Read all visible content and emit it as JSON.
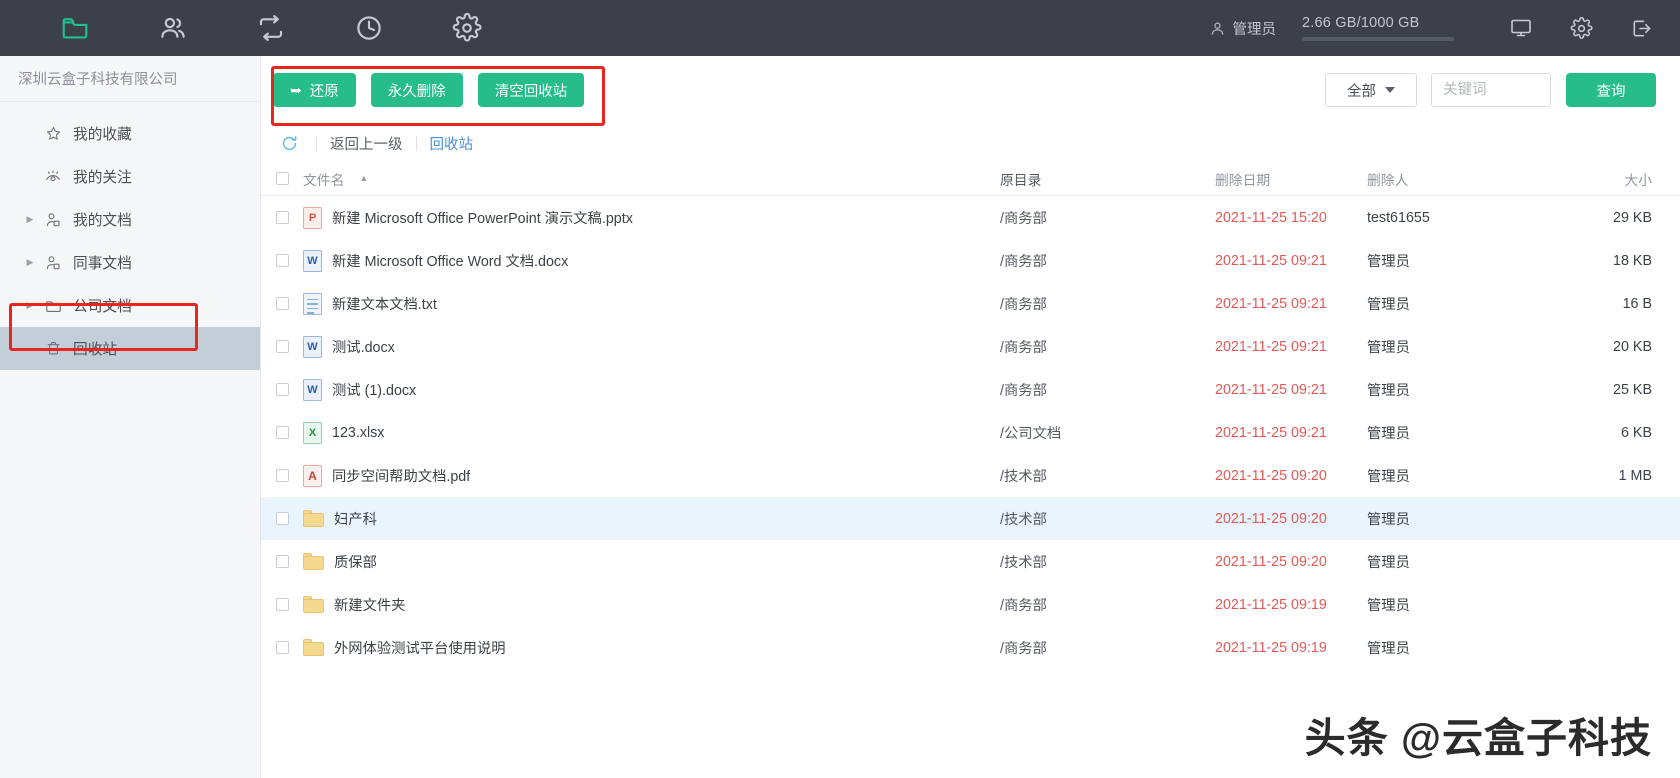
{
  "topbar": {
    "nav": [
      {
        "name": "folder-icon",
        "label": "文档",
        "active": true
      },
      {
        "name": "users-icon",
        "label": "用户",
        "active": false
      },
      {
        "name": "sync-icon",
        "label": "同步",
        "active": false
      },
      {
        "name": "clock-icon",
        "label": "历史",
        "active": false
      },
      {
        "name": "gear-icon",
        "label": "设置",
        "active": false
      }
    ],
    "user_name": "管理员",
    "storage_text": "2.66 GB/1000 GB",
    "storage_percent": 88,
    "actions": [
      {
        "name": "monitor-icon",
        "label": "客户端"
      },
      {
        "name": "settings-icon",
        "label": "设置"
      },
      {
        "name": "logout-icon",
        "label": "退出"
      }
    ]
  },
  "sidebar": {
    "org_name": "深圳云盒子科技有限公司",
    "items": [
      {
        "label": "我的收藏",
        "icon": "star-icon",
        "expandable": false,
        "selected": false
      },
      {
        "label": "我的关注",
        "icon": "eye-icon",
        "expandable": false,
        "selected": false
      },
      {
        "label": "我的文档",
        "icon": "user-folder-icon",
        "expandable": true,
        "selected": false
      },
      {
        "label": "同事文档",
        "icon": "user-folder-icon",
        "expandable": true,
        "selected": false
      },
      {
        "label": "公司文档",
        "icon": "folder-icon",
        "expandable": true,
        "selected": false
      },
      {
        "label": "回收站",
        "icon": "trash-icon",
        "expandable": false,
        "selected": true
      }
    ]
  },
  "toolbar": {
    "restore_label": "还原",
    "delete_label": "永久删除",
    "empty_label": "清空回收站",
    "filter_value": "全部",
    "keyword_placeholder": "关键词",
    "keyword_value": "",
    "search_label": "查询"
  },
  "breadcrumb": {
    "refresh_label": "刷新",
    "back_label": "返回上一级",
    "current": "回收站"
  },
  "table": {
    "columns": {
      "name": "文件名",
      "dir": "原目录",
      "date": "删除日期",
      "who": "删除人",
      "size": "大小"
    },
    "sort_indicator": "▲",
    "rows": [
      {
        "icon": "ppt",
        "badge": "P",
        "name": "新建 Microsoft Office PowerPoint 演示文稿.pptx",
        "dir": "/商务部",
        "date": "2021-11-25 15:20",
        "who": "test61655",
        "size": "29 KB",
        "highlight": false
      },
      {
        "icon": "doc",
        "badge": "W",
        "name": "新建 Microsoft Office Word 文档.docx",
        "dir": "/商务部",
        "date": "2021-11-25 09:21",
        "who": "管理员",
        "size": "18 KB",
        "highlight": false
      },
      {
        "icon": "txt",
        "badge": "",
        "name": "新建文本文档.txt",
        "dir": "/商务部",
        "date": "2021-11-25 09:21",
        "who": "管理员",
        "size": "16 B",
        "highlight": false
      },
      {
        "icon": "doc",
        "badge": "W",
        "name": "测试.docx",
        "dir": "/商务部",
        "date": "2021-11-25 09:21",
        "who": "管理员",
        "size": "20 KB",
        "highlight": false
      },
      {
        "icon": "doc",
        "badge": "W",
        "name": "测试 (1).docx",
        "dir": "/商务部",
        "date": "2021-11-25 09:21",
        "who": "管理员",
        "size": "25 KB",
        "highlight": false
      },
      {
        "icon": "xls",
        "badge": "X",
        "name": "123.xlsx",
        "dir": "/公司文档",
        "date": "2021-11-25 09:21",
        "who": "管理员",
        "size": "6 KB",
        "highlight": false
      },
      {
        "icon": "pdf",
        "badge": "A",
        "name": "同步空间帮助文档.pdf",
        "dir": "/技术部",
        "date": "2021-11-25 09:20",
        "who": "管理员",
        "size": "1 MB",
        "highlight": false
      },
      {
        "icon": "folder",
        "badge": "",
        "name": "妇产科",
        "dir": "/技术部",
        "date": "2021-11-25 09:20",
        "who": "管理员",
        "size": "",
        "highlight": true
      },
      {
        "icon": "folder",
        "badge": "",
        "name": "质保部",
        "dir": "/技术部",
        "date": "2021-11-25 09:20",
        "who": "管理员",
        "size": "",
        "highlight": false
      },
      {
        "icon": "folder",
        "badge": "",
        "name": "新建文件夹",
        "dir": "/商务部",
        "date": "2021-11-25 09:19",
        "who": "管理员",
        "size": "",
        "highlight": false
      },
      {
        "icon": "folder",
        "badge": "",
        "name": "外网体验测试平台使用说明",
        "dir": "/商务部",
        "date": "2021-11-25 09:19",
        "who": "管理员",
        "size": "",
        "highlight": false
      }
    ]
  },
  "watermark": {
    "text": "头条 @云盒子科技"
  },
  "colors": {
    "accent_green": "#26bd8a",
    "date_red": "#e05a57",
    "annotation_red": "#e8251f",
    "topbar_bg": "#3b4049"
  }
}
